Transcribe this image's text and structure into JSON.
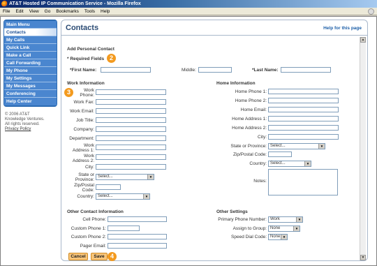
{
  "window": {
    "title": "AT&T Hosted IP Communication Service - Mozilla Firefox"
  },
  "menu": [
    "File",
    "Edit",
    "View",
    "Go",
    "Bookmarks",
    "Tools",
    "Help"
  ],
  "sidebar": {
    "items": [
      {
        "label": "Main Menu"
      },
      {
        "label": "Contacts"
      },
      {
        "label": "My Calls"
      },
      {
        "label": "Quick Link"
      },
      {
        "label": "Make a Call"
      },
      {
        "label": "Call Forwarding"
      },
      {
        "label": "My Phone"
      },
      {
        "label": "My Settings"
      },
      {
        "label": "My Messages"
      },
      {
        "label": "Conferencing"
      },
      {
        "label": "Help Center"
      }
    ],
    "active_index": 1,
    "copyright_line1": "© 2006 AT&T",
    "copyright_line2": "Knowledge Ventures.",
    "copyright_line3": "All rights reserved.",
    "privacy": "Privacy Policy"
  },
  "header": {
    "title": "Contacts",
    "help": "Help for this page"
  },
  "form": {
    "section_title": "Add Personal Contact",
    "required_note": "* Required Fields",
    "first_name": "*First Name:",
    "middle": "Middle:",
    "last_name": "*Last Name:",
    "work": {
      "title": "Work Information",
      "phone_l1": "Work",
      "phone_l2": "Phone:",
      "fax": "Work Fax:",
      "email": "Work Email:",
      "job_title": "Job Title:",
      "company": "Company:",
      "department": "Department:",
      "addr1_l1": "Work",
      "addr1_l2": "Address 1:",
      "addr2_l1": "Work",
      "addr2_l2": "Address 2:",
      "city": "City:",
      "state_l1": "State or",
      "state_l2": "Province:",
      "state_value": "Select...",
      "zip_l1": "Zip/Postal",
      "zip_l2": "Code:",
      "country": "Country:",
      "country_value": "Select..."
    },
    "home": {
      "title": "Home Information",
      "phone1": "Home Phone 1:",
      "phone2": "Home Phone 2:",
      "email": "Home Email:",
      "addr1": "Home Address 1:",
      "addr2": "Home Address 2:",
      "city": "City:",
      "state": "State or Province:",
      "state_value": "Select...",
      "zip": "Zip/Postal Code:",
      "country": "Country:",
      "country_value": "Select...",
      "notes": "Notes:"
    },
    "other_contact": {
      "title": "Other Contact Information",
      "cell": "Cell Phone:",
      "custom1": "Custom Phone 1:",
      "custom2": "Custom Phone 2:",
      "pager": "Pager Email:"
    },
    "other_settings": {
      "title": "Other Settings",
      "primary": "Primary Phone Number:",
      "primary_value": "Work",
      "group": "Assign to Group:",
      "group_value": "None",
      "speed": "Speed Dial Code:",
      "speed_value": "None"
    },
    "cancel": "Cancel",
    "save": "Save"
  },
  "callouts": [
    "2",
    "3",
    "4"
  ]
}
